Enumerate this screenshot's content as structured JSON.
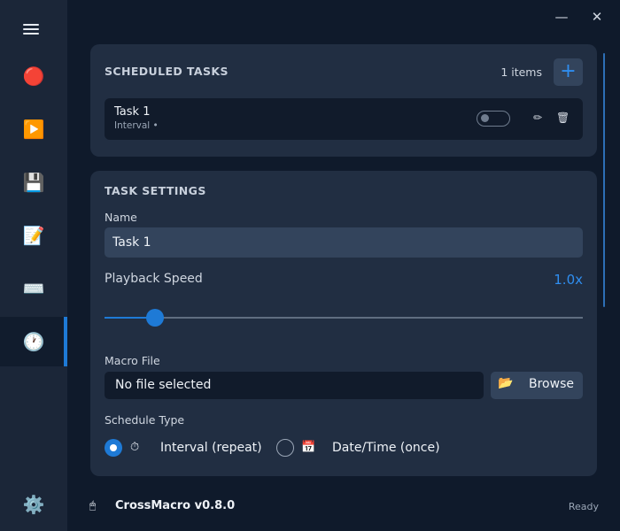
{
  "window": {
    "minimize_label": "—",
    "close_label": "✕"
  },
  "sidebar": {
    "items": [
      {
        "name": "record",
        "icon": "🔴"
      },
      {
        "name": "play",
        "icon": "▶️"
      },
      {
        "name": "save",
        "icon": "💾"
      },
      {
        "name": "editor",
        "icon": "📝"
      },
      {
        "name": "keyboard",
        "icon": "⌨️"
      },
      {
        "name": "scheduler",
        "icon": "🕐",
        "active": true
      }
    ],
    "settings_icon": "⚙️"
  },
  "scheduled_tasks": {
    "title": "SCHEDULED TASKS",
    "count_label": "1 items",
    "add_label": "+",
    "tasks": [
      {
        "name": "Task 1",
        "subtitle": "Interval •",
        "enabled": false,
        "edit_icon": "✏",
        "delete_icon": "🗑"
      }
    ]
  },
  "task_settings": {
    "title": "TASK SETTINGS",
    "name_label": "Name",
    "name_value": "Task 1",
    "speed_label": "Playback Speed",
    "speed_value": "1.0x",
    "speed_fraction": 0.105,
    "macro_file_label": "Macro File",
    "macro_file_value": "No file selected",
    "browse_icon": "📂",
    "browse_label": "Browse",
    "schedule_type_label": "Schedule Type",
    "schedule_options": [
      {
        "icon": "⏱",
        "label": "Interval (repeat)",
        "selected": true
      },
      {
        "icon": "📅",
        "label": "Date/Time (once)",
        "selected": false
      }
    ]
  },
  "footer": {
    "icon": "🖱",
    "title": "CrossMacro v0.8.0",
    "status": "Ready"
  },
  "colors": {
    "accent": "#1e7ad6",
    "background": "#0f1a2b",
    "card": "#212e42",
    "sidebar": "#1b2638"
  }
}
